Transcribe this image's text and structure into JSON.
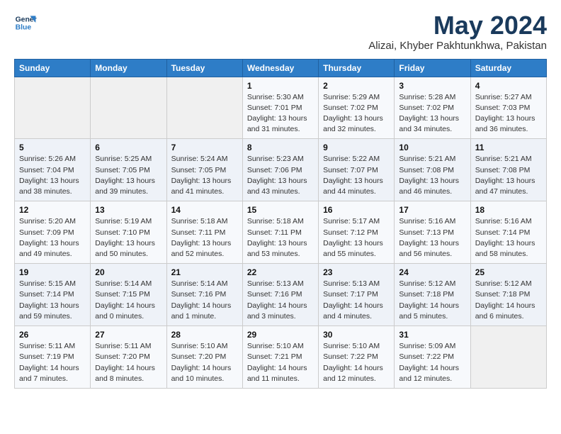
{
  "logo": {
    "line1": "General",
    "line2": "Blue"
  },
  "title": "May 2024",
  "subtitle": "Alizai, Khyber Pakhtunkhwa, Pakistan",
  "headers": [
    "Sunday",
    "Monday",
    "Tuesday",
    "Wednesday",
    "Thursday",
    "Friday",
    "Saturday"
  ],
  "weeks": [
    [
      {
        "day": "",
        "info": ""
      },
      {
        "day": "",
        "info": ""
      },
      {
        "day": "",
        "info": ""
      },
      {
        "day": "1",
        "info": "Sunrise: 5:30 AM\nSunset: 7:01 PM\nDaylight: 13 hours\nand 31 minutes."
      },
      {
        "day": "2",
        "info": "Sunrise: 5:29 AM\nSunset: 7:02 PM\nDaylight: 13 hours\nand 32 minutes."
      },
      {
        "day": "3",
        "info": "Sunrise: 5:28 AM\nSunset: 7:02 PM\nDaylight: 13 hours\nand 34 minutes."
      },
      {
        "day": "4",
        "info": "Sunrise: 5:27 AM\nSunset: 7:03 PM\nDaylight: 13 hours\nand 36 minutes."
      }
    ],
    [
      {
        "day": "5",
        "info": "Sunrise: 5:26 AM\nSunset: 7:04 PM\nDaylight: 13 hours\nand 38 minutes."
      },
      {
        "day": "6",
        "info": "Sunrise: 5:25 AM\nSunset: 7:05 PM\nDaylight: 13 hours\nand 39 minutes."
      },
      {
        "day": "7",
        "info": "Sunrise: 5:24 AM\nSunset: 7:05 PM\nDaylight: 13 hours\nand 41 minutes."
      },
      {
        "day": "8",
        "info": "Sunrise: 5:23 AM\nSunset: 7:06 PM\nDaylight: 13 hours\nand 43 minutes."
      },
      {
        "day": "9",
        "info": "Sunrise: 5:22 AM\nSunset: 7:07 PM\nDaylight: 13 hours\nand 44 minutes."
      },
      {
        "day": "10",
        "info": "Sunrise: 5:21 AM\nSunset: 7:08 PM\nDaylight: 13 hours\nand 46 minutes."
      },
      {
        "day": "11",
        "info": "Sunrise: 5:21 AM\nSunset: 7:08 PM\nDaylight: 13 hours\nand 47 minutes."
      }
    ],
    [
      {
        "day": "12",
        "info": "Sunrise: 5:20 AM\nSunset: 7:09 PM\nDaylight: 13 hours\nand 49 minutes."
      },
      {
        "day": "13",
        "info": "Sunrise: 5:19 AM\nSunset: 7:10 PM\nDaylight: 13 hours\nand 50 minutes."
      },
      {
        "day": "14",
        "info": "Sunrise: 5:18 AM\nSunset: 7:11 PM\nDaylight: 13 hours\nand 52 minutes."
      },
      {
        "day": "15",
        "info": "Sunrise: 5:18 AM\nSunset: 7:11 PM\nDaylight: 13 hours\nand 53 minutes."
      },
      {
        "day": "16",
        "info": "Sunrise: 5:17 AM\nSunset: 7:12 PM\nDaylight: 13 hours\nand 55 minutes."
      },
      {
        "day": "17",
        "info": "Sunrise: 5:16 AM\nSunset: 7:13 PM\nDaylight: 13 hours\nand 56 minutes."
      },
      {
        "day": "18",
        "info": "Sunrise: 5:16 AM\nSunset: 7:14 PM\nDaylight: 13 hours\nand 58 minutes."
      }
    ],
    [
      {
        "day": "19",
        "info": "Sunrise: 5:15 AM\nSunset: 7:14 PM\nDaylight: 13 hours\nand 59 minutes."
      },
      {
        "day": "20",
        "info": "Sunrise: 5:14 AM\nSunset: 7:15 PM\nDaylight: 14 hours\nand 0 minutes."
      },
      {
        "day": "21",
        "info": "Sunrise: 5:14 AM\nSunset: 7:16 PM\nDaylight: 14 hours\nand 1 minute."
      },
      {
        "day": "22",
        "info": "Sunrise: 5:13 AM\nSunset: 7:16 PM\nDaylight: 14 hours\nand 3 minutes."
      },
      {
        "day": "23",
        "info": "Sunrise: 5:13 AM\nSunset: 7:17 PM\nDaylight: 14 hours\nand 4 minutes."
      },
      {
        "day": "24",
        "info": "Sunrise: 5:12 AM\nSunset: 7:18 PM\nDaylight: 14 hours\nand 5 minutes."
      },
      {
        "day": "25",
        "info": "Sunrise: 5:12 AM\nSunset: 7:18 PM\nDaylight: 14 hours\nand 6 minutes."
      }
    ],
    [
      {
        "day": "26",
        "info": "Sunrise: 5:11 AM\nSunset: 7:19 PM\nDaylight: 14 hours\nand 7 minutes."
      },
      {
        "day": "27",
        "info": "Sunrise: 5:11 AM\nSunset: 7:20 PM\nDaylight: 14 hours\nand 8 minutes."
      },
      {
        "day": "28",
        "info": "Sunrise: 5:10 AM\nSunset: 7:20 PM\nDaylight: 14 hours\nand 10 minutes."
      },
      {
        "day": "29",
        "info": "Sunrise: 5:10 AM\nSunset: 7:21 PM\nDaylight: 14 hours\nand 11 minutes."
      },
      {
        "day": "30",
        "info": "Sunrise: 5:10 AM\nSunset: 7:22 PM\nDaylight: 14 hours\nand 12 minutes."
      },
      {
        "day": "31",
        "info": "Sunrise: 5:09 AM\nSunset: 7:22 PM\nDaylight: 14 hours\nand 12 minutes."
      },
      {
        "day": "",
        "info": ""
      }
    ]
  ]
}
